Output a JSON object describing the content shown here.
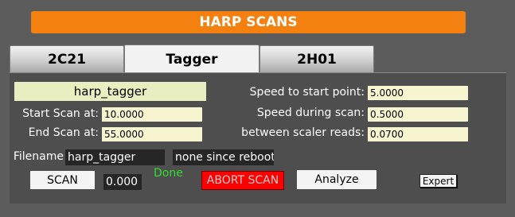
{
  "title": "HARP SCANS",
  "tabs": [
    {
      "label": "2C21",
      "active": false
    },
    {
      "label": "Tagger",
      "active": true
    },
    {
      "label": "2H01",
      "active": false
    }
  ],
  "harp_name": "harp_tagger",
  "fields": {
    "start_scan": {
      "label": "Start Scan at:",
      "value": "10.0000"
    },
    "end_scan": {
      "label": "End Scan at:",
      "value": "55.0000"
    },
    "speed_start": {
      "label": "Speed to start point:",
      "value": "5.0000"
    },
    "speed_during": {
      "label": "Speed during scan:",
      "value": "0.5000"
    },
    "scaler_time": {
      "label": "Time between scaler reads:",
      "value": "0.0700"
    }
  },
  "filename": {
    "label": "Filename",
    "value": "harp_tagger",
    "status": "none since reboot"
  },
  "buttons": {
    "scan": "SCAN",
    "abort": "ABORT SCAN",
    "analyze": "Analyze",
    "expert": "Expert"
  },
  "readout": "0.000",
  "status_done": "Done",
  "colors": {
    "title_bg": "#f3800f",
    "background": "#5c5c5c",
    "panel": "#4e4e4e",
    "field_bg": "#f7f5cf",
    "name_bg": "#e8eec0",
    "abort_bg": "#ff0000",
    "done_text": "#33dd33"
  }
}
